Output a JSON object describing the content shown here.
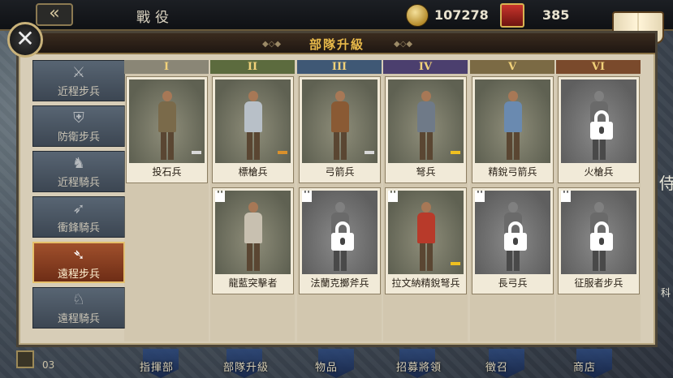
{
  "header": {
    "back_icon": "back-arrow-icon",
    "title": "戰役",
    "gold": "107278",
    "crowns": "385",
    "codex_label": "圖鑒"
  },
  "panel": {
    "title": "部隊升級",
    "close_icon": "close-icon"
  },
  "sidebar": {
    "items": [
      {
        "label": "近程步兵",
        "icon": "crossed-swords-icon",
        "active": false
      },
      {
        "label": "防衛步兵",
        "icon": "shield-icon",
        "active": false
      },
      {
        "label": "近程騎兵",
        "icon": "horse-head-icon",
        "active": false
      },
      {
        "label": "衝鋒騎兵",
        "icon": "lance-icon",
        "active": false
      },
      {
        "label": "遠程步兵",
        "icon": "bow-icon",
        "active": true
      },
      {
        "label": "遠程騎兵",
        "icon": "horse-archer-icon",
        "active": false
      }
    ]
  },
  "tiers": [
    {
      "label": "I",
      "color": "#8a8676"
    },
    {
      "label": "II",
      "color": "#5c6b3e"
    },
    {
      "label": "III",
      "color": "#3f5875"
    },
    {
      "label": "IV",
      "color": "#4b3f6e"
    },
    {
      "label": "V",
      "color": "#7b6a44"
    },
    {
      "label": "VI",
      "color": "#7a4a2c"
    }
  ],
  "units": [
    {
      "name": "投石兵",
      "locked": false,
      "chip": "#d8d8d8",
      "body": "#7a6a4a"
    },
    {
      "name": "標槍兵",
      "locked": false,
      "chip": "#d9902c",
      "body": "#b8c0c8"
    },
    {
      "name": "弓箭兵",
      "locked": false,
      "chip": "#d8d8d8",
      "body": "#8a5a34"
    },
    {
      "name": "弩兵",
      "locked": false,
      "chip": "#f0c020",
      "body": "#6f7a88"
    },
    {
      "name": "精銳弓箭兵",
      "locked": false,
      "chip": "",
      "body": "#6a8ab0"
    },
    {
      "name": "火槍兵",
      "locked": true,
      "chip": "",
      "body": "#6a6a66"
    },
    {
      "name": "龍藍突擊者",
      "locked": false,
      "chip": "",
      "body": "#c8c0b0"
    },
    {
      "name": "法蘭克擲斧兵",
      "locked": true,
      "chip": "",
      "body": "#6a6a66"
    },
    {
      "name": "拉文納精銳弩兵",
      "locked": false,
      "chip": "#f0c020",
      "body": "#b83a2a"
    },
    {
      "name": "長弓兵",
      "locked": true,
      "chip": "",
      "body": "#6a6a66"
    },
    {
      "name": "征服者步兵",
      "locked": true,
      "chip": "",
      "body": "#6a6a66"
    }
  ],
  "bottom_nav": [
    "指揮部",
    "部隊升級",
    "物品",
    "招募將領",
    "徵召",
    "商店"
  ],
  "pager": "03",
  "edge_text": {
    "right_a": "侍",
    "right_b": "科"
  }
}
